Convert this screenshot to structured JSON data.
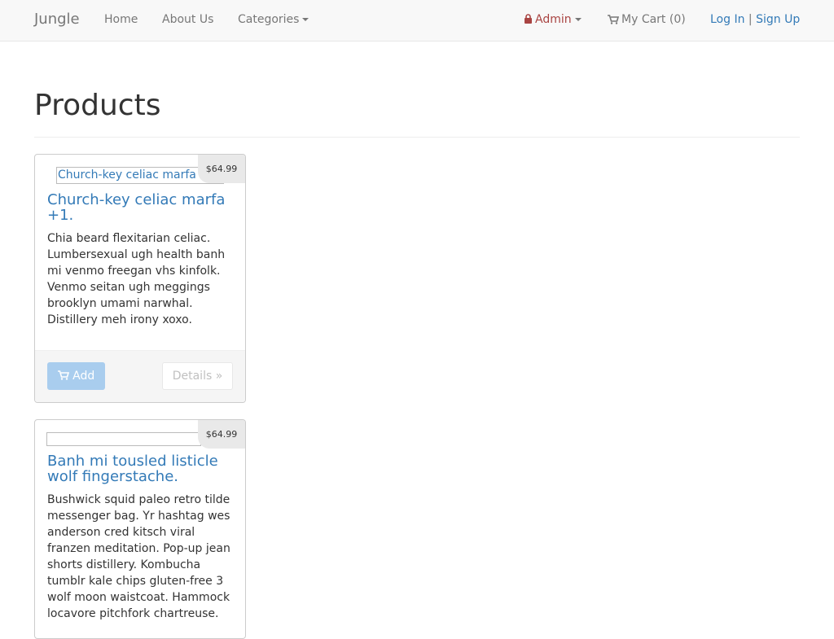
{
  "navbar": {
    "brand": "Jungle",
    "home": "Home",
    "about": "About Us",
    "categories": "Categories",
    "admin": "Admin",
    "cart": "My Cart (0)",
    "login": "Log In",
    "separator": "|",
    "signup": "Sign Up"
  },
  "page": {
    "title": "Products"
  },
  "products": [
    {
      "image_alt": "Church-key celiac marfa",
      "price": "$64.99",
      "title": "Church-key celiac marfa +1.",
      "description": "Chia beard flexitarian celiac. Lumbersexual ugh health banh mi venmo freegan vhs kinfolk. Venmo seitan ugh meggings brooklyn umami narwhal. Distillery meh irony xoxo.",
      "add_label": "Add",
      "details_label": "Details »"
    },
    {
      "image_alt": "",
      "price": "$64.99",
      "title": "Banh mi tousled listicle wolf fingerstache.",
      "description": "Bushwick squid paleo retro tilde messenger bag. Yr hashtag wes anderson cred kitsch viral franzen meditation. Pop-up jean shorts distillery. Kombucha tumblr kale chips gluten-free 3 wolf moon waistcoat. Hammock locavore pitchfork chartreuse."
    }
  ],
  "colors": {
    "link": "#337ab7",
    "admin": "#a94442",
    "navbar_bg": "#f8f8f8"
  }
}
